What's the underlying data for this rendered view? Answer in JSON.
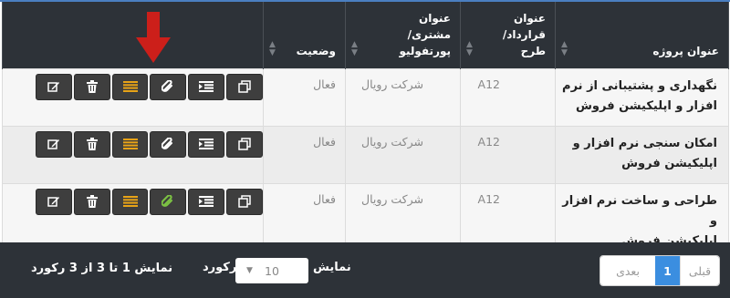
{
  "table": {
    "headers": {
      "title": "عنوان پروژه",
      "contract": [
        "عنوان",
        "قرارداد/",
        "طرح"
      ],
      "client": [
        "عنوان",
        "مشتری/",
        "پورتفولیو"
      ],
      "status": "وضعیت"
    },
    "rows": [
      {
        "title": [
          "نگهداری و پشتیبانی از نرم",
          "افزار و اپلیکیشن فروش"
        ],
        "code": "A12",
        "client": "شرکت رویال",
        "status": "فعال",
        "attach_highlight": false
      },
      {
        "title": [
          "امکان سنجی نرم افزار و",
          "اپلیکیشن فروش"
        ],
        "code": "A12",
        "client": "شرکت رویال",
        "status": "فعال",
        "attach_highlight": false
      },
      {
        "title": [
          "طراحی و ساخت نرم افزار و",
          "اپلیکیشن فروش"
        ],
        "code": "A12",
        "client": "شرکت رویال",
        "status": "فعال",
        "attach_highlight": true
      }
    ],
    "action_icons": [
      "edit-icon",
      "trash-icon",
      "list-icon",
      "paperclip-icon",
      "indent-list-icon",
      "copy-icon"
    ]
  },
  "footer": {
    "pager": {
      "prev": "قبلی",
      "current": "1",
      "next": "بعدی"
    },
    "show_label": "نمایش",
    "page_size": "10",
    "records_label": "رکورد",
    "info": "نمایش 1 تا 3 از 3 رکورد"
  },
  "colors": {
    "header_bg": "#2d3238",
    "button_bg": "#3e3e3e",
    "list_icon": "#e8a317",
    "attach_highlight": "#7cc243",
    "arrow": "#cc1f1a",
    "pager_active": "#3b8ee0"
  }
}
